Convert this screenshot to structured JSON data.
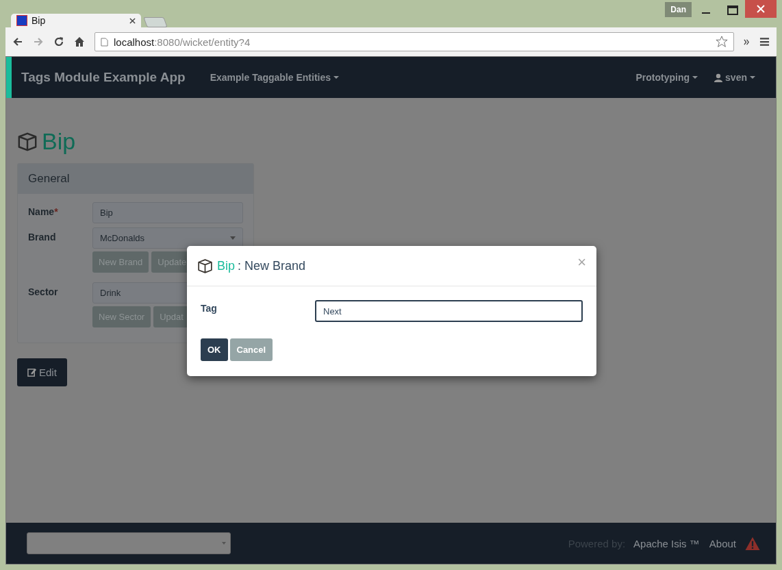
{
  "browser": {
    "tab_title": "Bip",
    "profile": "Dan",
    "url_host": "localhost",
    "url_path": ":8080/wicket/entity?4"
  },
  "navbar": {
    "brand": "Tags Module Example App",
    "menus": [
      {
        "label": "Example Taggable Entities"
      }
    ],
    "right_menus": [
      {
        "label": "Prototyping",
        "kind": "menu"
      },
      {
        "label": "sven",
        "kind": "user"
      }
    ]
  },
  "entity": {
    "title": "Bip"
  },
  "panel": {
    "title": "General",
    "required_mark": "*",
    "fields": [
      {
        "label": "Name",
        "required": true,
        "kind": "text",
        "value": "Bip"
      },
      {
        "label": "Brand",
        "required": false,
        "kind": "select",
        "value": "McDonalds",
        "buttons": [
          "New Brand",
          "Update"
        ]
      },
      {
        "label": "Sector",
        "required": false,
        "kind": "select",
        "value": "Drink",
        "buttons": [
          "New Sector",
          "Updat"
        ]
      }
    ]
  },
  "edit_button": "Edit",
  "dialog": {
    "entity": "Bip",
    "title": ": New Brand",
    "close": "×",
    "fields": [
      {
        "label": "Tag",
        "value": "Next"
      }
    ],
    "buttons": [
      {
        "label": "OK",
        "kind": "primary"
      },
      {
        "label": "Cancel",
        "kind": "secondary"
      }
    ]
  },
  "footer": {
    "powered_by": "Powered by:",
    "credit": "Apache Isis ™",
    "about": "About"
  }
}
